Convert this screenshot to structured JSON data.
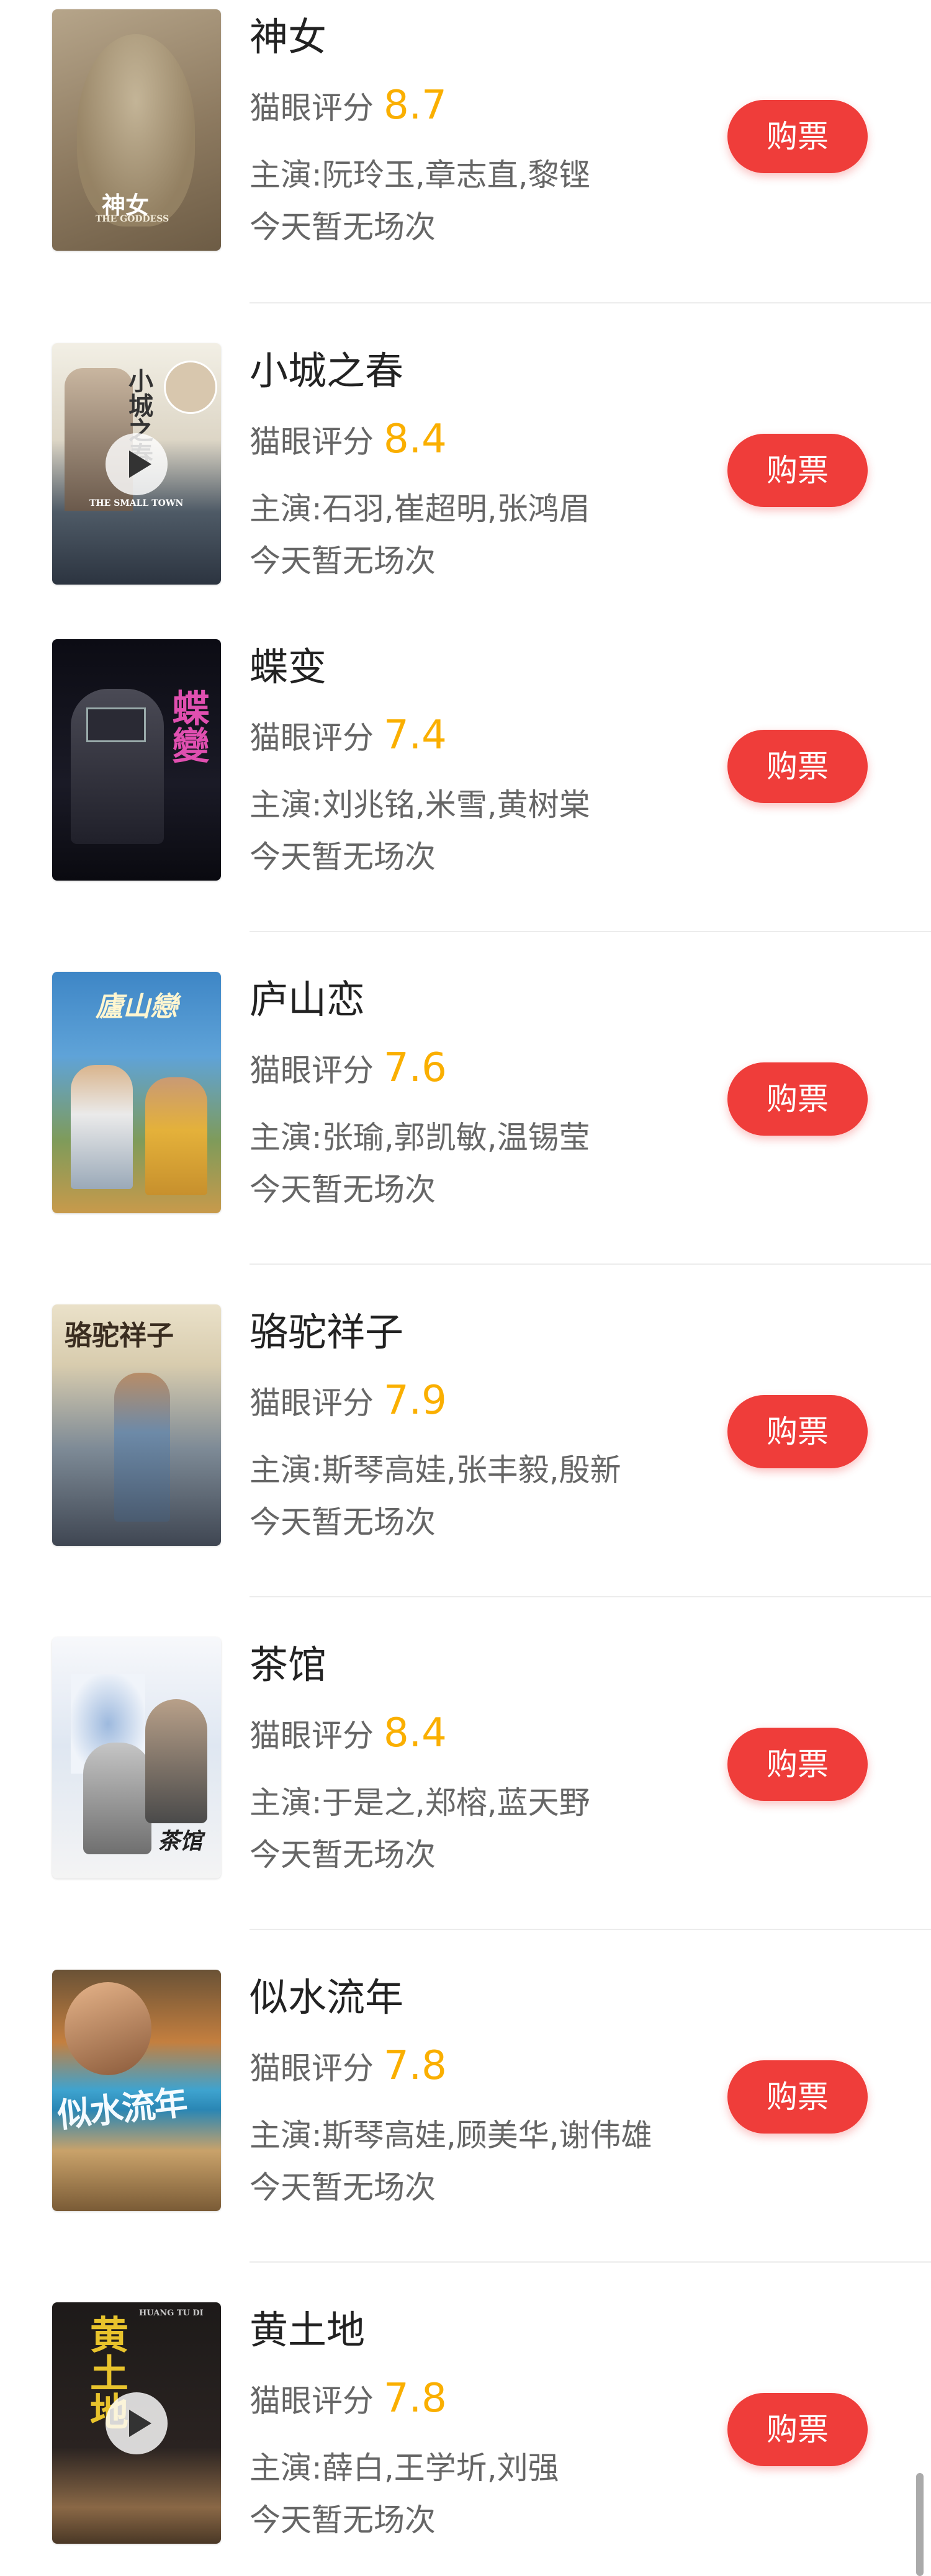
{
  "score_label": "猫眼评分",
  "buy_label": "购票",
  "movies": [
    {
      "title": "神女",
      "score": "8.7",
      "cast": "主演:阮玲玉,章志直,黎铿",
      "showtime": "今天暂无场次",
      "poster_text": "神女",
      "poster_subtext": "THE GODDESS"
    },
    {
      "title": "小城之春",
      "score": "8.4",
      "cast": "主演:石羽,崔超明,张鸿眉",
      "showtime": "今天暂无场次",
      "poster_text": "小城之春",
      "poster_subtext": "THE SMALL TOWN"
    },
    {
      "title": "蝶变",
      "score": "7.4",
      "cast": "主演:刘兆铭,米雪,黄树棠",
      "showtime": "今天暂无场次",
      "poster_text": "蝶變",
      "poster_subtext": ""
    },
    {
      "title": "庐山恋",
      "score": "7.6",
      "cast": "主演:张瑜,郭凯敏,温锡莹",
      "showtime": "今天暂无场次",
      "poster_text": "廬山戀",
      "poster_subtext": ""
    },
    {
      "title": "骆驼祥子",
      "score": "7.9",
      "cast": "主演:斯琴高娃,张丰毅,殷新",
      "showtime": "今天暂无场次",
      "poster_text": "骆驼祥子",
      "poster_subtext": ""
    },
    {
      "title": "茶馆",
      "score": "8.4",
      "cast": "主演:于是之,郑榕,蓝天野",
      "showtime": "今天暂无场次",
      "poster_text": "茶馆",
      "poster_subtext": ""
    },
    {
      "title": "似水流年",
      "score": "7.8",
      "cast": "主演:斯琴高娃,顾美华,谢伟雄",
      "showtime": "今天暂无场次",
      "poster_text": "似水流年",
      "poster_subtext": ""
    },
    {
      "title": "黄土地",
      "score": "7.8",
      "cast": "主演:薛白,王学圻,刘强",
      "showtime": "今天暂无场次",
      "poster_text": "黄土地",
      "poster_subtext": "HUANG TU DI"
    }
  ],
  "colors": {
    "accent": "#ef3d3a",
    "score": "#faaf00",
    "text_primary": "#222222",
    "text_secondary": "#666666",
    "divider": "#ececec"
  }
}
